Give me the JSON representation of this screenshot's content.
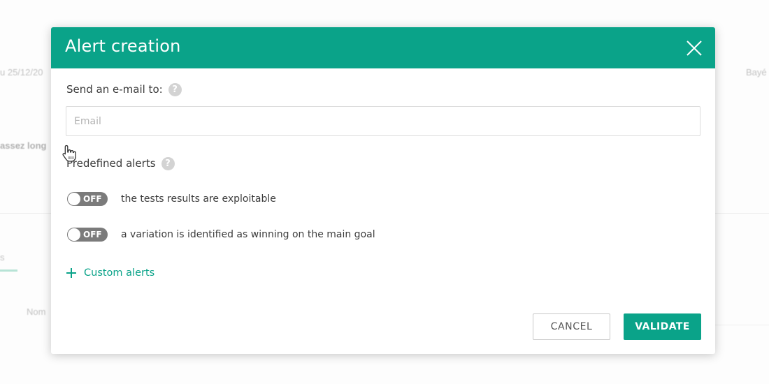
{
  "background": {
    "date_fragment": "u 25/12/20",
    "name_fragment": "Bayé",
    "bold_fragment": "assez long",
    "tab_fragment": "s",
    "column_fragment": "Nom"
  },
  "modal": {
    "title": "Alert creation",
    "close_icon": "close-icon",
    "accent_color": "#0aa389",
    "email_section": {
      "label": "Send an e-mail to:",
      "help_icon": "help-icon",
      "help_glyph": "?",
      "input_value": "",
      "input_placeholder": "Email"
    },
    "predefined_section": {
      "label": "Predefined alerts",
      "help_icon": "help-icon",
      "help_glyph": "?",
      "alerts": [
        {
          "state_label": "OFF",
          "enabled": false,
          "label": "the tests results are exploitable"
        },
        {
          "state_label": "OFF",
          "enabled": false,
          "label": "a variation is identified as winning on the main goal"
        }
      ]
    },
    "custom_alerts": {
      "icon": "plus-icon",
      "label": "Custom alerts"
    },
    "buttons": {
      "cancel_label": "CANCEL",
      "validate_label": "VALIDATE"
    }
  },
  "cursor": {
    "icon": "hand-pointer-icon"
  }
}
